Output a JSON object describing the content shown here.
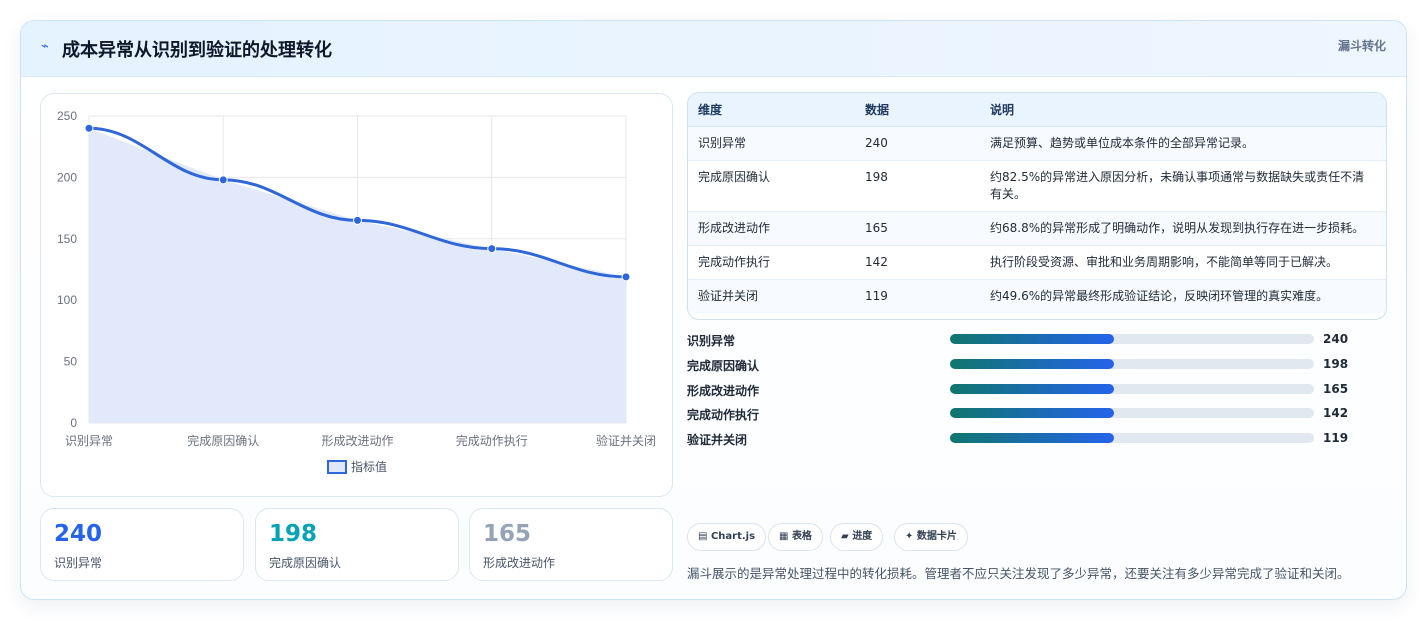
{
  "header": {
    "icon": "spark-icon",
    "title": "成本异常从识别到验证的处理转化",
    "tag": "漏斗转化"
  },
  "chart_data": {
    "type": "area",
    "categories": [
      "识别异常",
      "完成原因确认",
      "形成改进动作",
      "完成动作执行",
      "验证并关闭"
    ],
    "series": [
      {
        "name": "指标值",
        "values": [
          240,
          198,
          165,
          142,
          119
        ]
      }
    ],
    "ylim": [
      0,
      250
    ],
    "yticks": [
      0,
      50,
      100,
      150,
      200,
      250
    ],
    "grid": true,
    "legend": "bottom",
    "colors": {
      "line": "#2f67d8",
      "fill": "#dfe8fb"
    }
  },
  "kpis": [
    {
      "value": "240",
      "label": "识别异常",
      "color": "#2563eb"
    },
    {
      "value": "198",
      "label": "完成原因确认",
      "color": "#06a3b7"
    },
    {
      "value": "165",
      "label": "形成改进动作",
      "color": "#94a3b8"
    }
  ],
  "table": {
    "headers": [
      "维度",
      "数据",
      "说明"
    ],
    "rows": [
      {
        "dim": "识别异常",
        "val": "240",
        "desc": "满足预算、趋势或单位成本条件的全部异常记录。"
      },
      {
        "dim": "完成原因确认",
        "val": "198",
        "desc": "约82.5%的异常进入原因分析，未确认事项通常与数据缺失或责任不清有关。"
      },
      {
        "dim": "形成改进动作",
        "val": "165",
        "desc": "约68.8%的异常形成了明确动作，说明从发现到执行存在进一步损耗。"
      },
      {
        "dim": "完成动作执行",
        "val": "142",
        "desc": "执行阶段受资源、审批和业务周期影响，不能简单等同于已解决。"
      },
      {
        "dim": "验证并关闭",
        "val": "119",
        "desc": "约49.6%的异常最终形成验证结论，反映闭环管理的真实难度。"
      }
    ]
  },
  "progress": [
    {
      "label": "识别异常",
      "value": "240",
      "fraction": 0.45
    },
    {
      "label": "完成原因确认",
      "value": "198",
      "fraction": 0.45
    },
    {
      "label": "形成改进动作",
      "value": "165",
      "fraction": 0.45
    },
    {
      "label": "完成动作执行",
      "value": "142",
      "fraction": 0.45
    },
    {
      "label": "验证并关闭",
      "value": "119",
      "fraction": 0.45
    }
  ],
  "chips": [
    {
      "icon": "chart-icon",
      "glyph": "▤",
      "label": "Chart.js"
    },
    {
      "icon": "table-icon",
      "glyph": "▦",
      "label": "表格"
    },
    {
      "icon": "progress-icon",
      "glyph": "▰",
      "label": "进度"
    },
    {
      "icon": "card-icon",
      "glyph": "✦",
      "label": "数据卡片"
    }
  ],
  "footnote": "漏斗展示的是异常处理过程中的转化损耗。管理者不应只关注发现了多少异常，还要关注有多少异常完成了验证和关闭。"
}
